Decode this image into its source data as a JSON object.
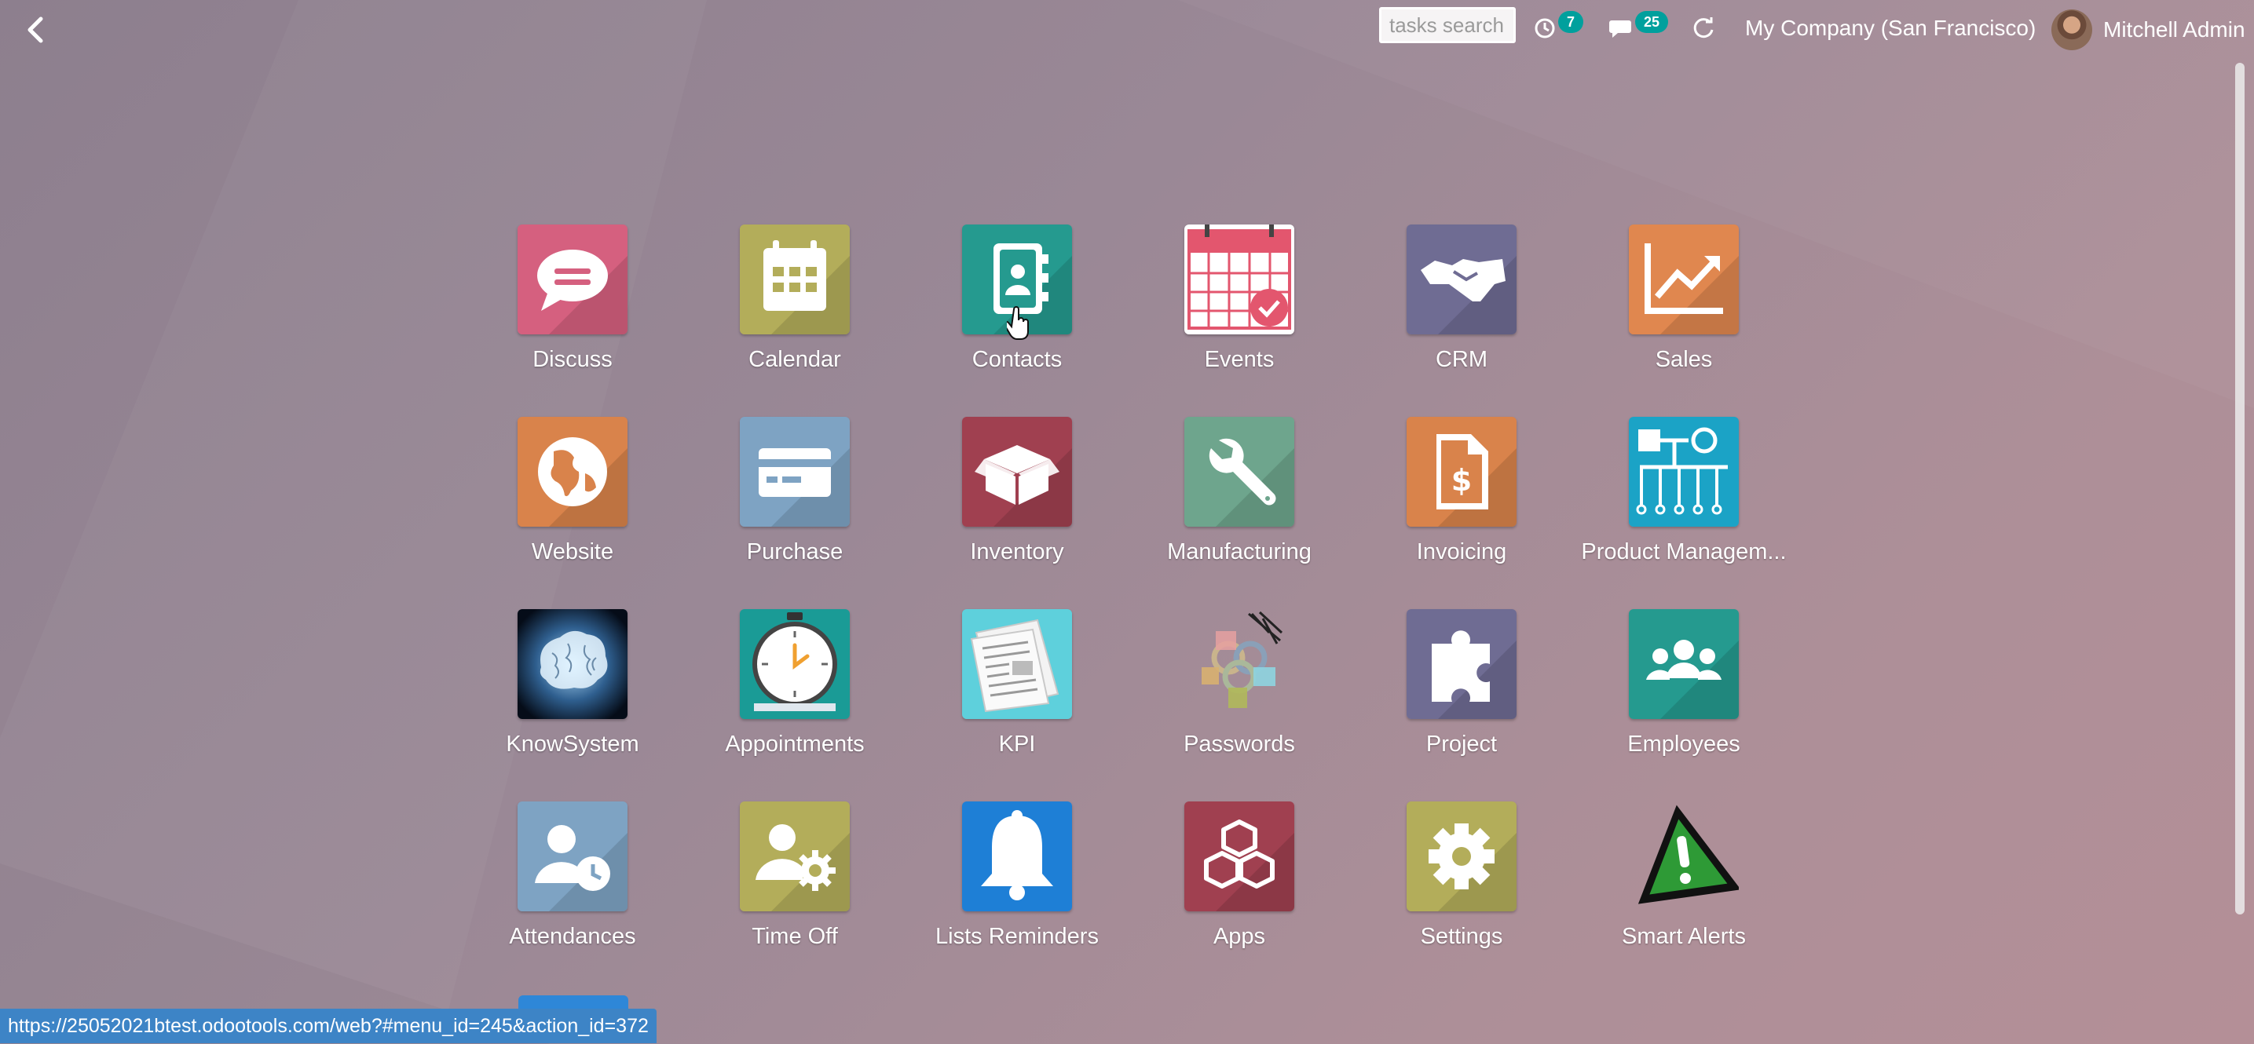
{
  "topbar": {
    "search_placeholder": "tasks search",
    "activity_count": "7",
    "messages_count": "25",
    "company": "My Company (San Francisco)",
    "user_name": "Mitchell Admin"
  },
  "apps": [
    {
      "label": "Discuss",
      "icon": "discuss-icon"
    },
    {
      "label": "Calendar",
      "icon": "calendar-icon"
    },
    {
      "label": "Contacts",
      "icon": "contacts-icon"
    },
    {
      "label": "Events",
      "icon": "events-icon"
    },
    {
      "label": "CRM",
      "icon": "crm-icon"
    },
    {
      "label": "Sales",
      "icon": "sales-icon"
    },
    {
      "label": "Website",
      "icon": "website-icon"
    },
    {
      "label": "Purchase",
      "icon": "purchase-icon"
    },
    {
      "label": "Inventory",
      "icon": "inventory-icon"
    },
    {
      "label": "Manufacturing",
      "icon": "manufacturing-icon"
    },
    {
      "label": "Invoicing",
      "icon": "invoicing-icon"
    },
    {
      "label": "Product Managem...",
      "icon": "product-management-icon"
    },
    {
      "label": "KnowSystem",
      "icon": "knowsystem-icon"
    },
    {
      "label": "Appointments",
      "icon": "appointments-icon"
    },
    {
      "label": "KPI",
      "icon": "kpi-icon"
    },
    {
      "label": "Passwords",
      "icon": "passwords-icon"
    },
    {
      "label": "Project",
      "icon": "project-icon"
    },
    {
      "label": "Employees",
      "icon": "employees-icon"
    },
    {
      "label": "Attendances",
      "icon": "attendances-icon"
    },
    {
      "label": "Time Off",
      "icon": "time-off-icon"
    },
    {
      "label": "Lists Reminders",
      "icon": "lists-reminders-icon"
    },
    {
      "label": "Apps",
      "icon": "apps-icon"
    },
    {
      "label": "Settings",
      "icon": "settings-icon"
    },
    {
      "label": "Smart Alerts",
      "icon": "smart-alerts-icon"
    }
  ],
  "status_url": "https://25052021btest.odootools.com/web?#menu_id=245&action_id=372",
  "colors": {
    "badge": "#00a09d",
    "status_bar": "#3d84c6"
  }
}
